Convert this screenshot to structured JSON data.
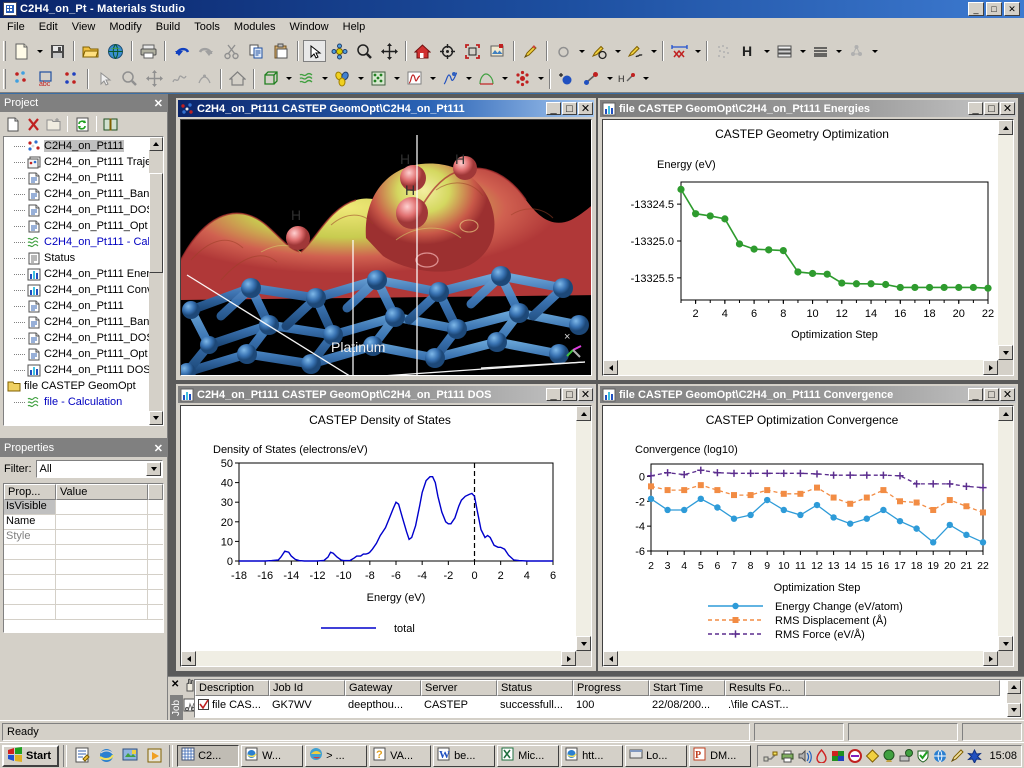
{
  "app": {
    "title": "C2H4_on_Pt - Materials Studio",
    "icon": "materials-studio-icon",
    "status": "Ready"
  },
  "window_buttons": {
    "minimize": "_",
    "maximize": "□",
    "close": "✕"
  },
  "menubar": [
    {
      "label": "File"
    },
    {
      "label": "Edit"
    },
    {
      "label": "View"
    },
    {
      "label": "Modify"
    },
    {
      "label": "Build"
    },
    {
      "label": "Tools"
    },
    {
      "label": "Modules"
    },
    {
      "label": "Window"
    },
    {
      "label": "Help"
    }
  ],
  "toolbar_row1": [
    "new-document-icon",
    "dropdown-arrow",
    "save-icon",
    "sep",
    "open-folder-icon",
    "web-globe-icon",
    "sep",
    "print-icon",
    "sep",
    "undo-icon",
    "redo-icon",
    "cut-icon",
    "copy-icon",
    "paste-icon",
    "sep",
    "select-arrow-icon",
    "rotate-icon",
    "zoom-icon",
    "translate-icon",
    "sep",
    "home-view-icon",
    "center-view-icon",
    "fit-view-icon",
    "display-style-icon",
    "sep",
    "sketch-atom-icon",
    "sep",
    "ring-icon",
    "dropdown-arrow",
    "sketch-ring-icon",
    "dropdown-arrow",
    "sketch-chain-icon",
    "dropdown-arrow",
    "sep",
    "measure-icon",
    "dropdown-arrow",
    "sep",
    "cleanup-icon",
    "hydrogen-icon",
    "dropdown-arrow",
    "layer-icon",
    "dropdown-arrow",
    "slab-icon",
    "dropdown-arrow",
    "symmetry-icon",
    "dropdown-arrow"
  ],
  "toolbar_row2": [
    "atom-label-icon",
    "abc-label-icon",
    "atom-color-icon",
    "sep",
    "select-arrow-icon",
    "zoom-icon",
    "translate-icon",
    "trajectory-icon",
    "animate-icon",
    "sep",
    "home-view-icon",
    "sep",
    "crystal-build-icon",
    "dropdown-arrow",
    "calculation-icon",
    "dropdown-arrow",
    "orbital-icon",
    "dropdown-arrow",
    "lattice-icon",
    "dropdown-arrow",
    "spectrum-icon",
    "dropdown-arrow",
    "dos-icon",
    "dropdown-arrow",
    "potential-icon",
    "dropdown-arrow",
    "atomistic-icon",
    "dropdown-arrow",
    "sep",
    "add-atom-icon",
    "bond-icon",
    "dropdown-arrow",
    "hydrogen-bond-icon",
    "dropdown-arrow"
  ],
  "project_panel": {
    "title": "Project",
    "close_label": "✕",
    "tools": [
      "new-project-icon",
      "delete-icon",
      "new-folder-icon",
      "sep",
      "refresh-icon",
      "sep",
      "help-book-icon"
    ],
    "items": [
      {
        "label": "C2H4_on_Pt111",
        "icon": "structure-3d-icon",
        "selected": true,
        "indent": 1
      },
      {
        "label": "C2H4_on_Pt111 Traje",
        "icon": "trajectory-doc-icon",
        "indent": 1
      },
      {
        "label": "C2H4_on_Pt111",
        "icon": "text-doc-icon",
        "indent": 1
      },
      {
        "label": "C2H4_on_Pt111_Ban",
        "icon": "text-doc-icon",
        "indent": 1
      },
      {
        "label": "C2H4_on_Pt111_DOS",
        "icon": "text-doc-icon",
        "indent": 1
      },
      {
        "label": "C2H4_on_Pt111_Opt",
        "icon": "text-doc-icon",
        "indent": 1
      },
      {
        "label": "C2H4_on_Pt111 - Cal",
        "icon": "calculation-icon",
        "calc": true,
        "indent": 1
      },
      {
        "label": "Status",
        "icon": "status-doc-icon",
        "indent": 1
      },
      {
        "label": "C2H4_on_Pt111 Ener",
        "icon": "chart-doc-icon",
        "indent": 1
      },
      {
        "label": "C2H4_on_Pt111 Conv",
        "icon": "chart-doc-icon",
        "indent": 1
      },
      {
        "label": "C2H4_on_Pt111",
        "icon": "text-doc-icon",
        "indent": 1
      },
      {
        "label": "C2H4_on_Pt111_Ban",
        "icon": "text-doc-icon",
        "indent": 1
      },
      {
        "label": "C2H4_on_Pt111_DOS",
        "icon": "text-doc-icon",
        "indent": 1
      },
      {
        "label": "C2H4_on_Pt111_Opt",
        "icon": "text-doc-icon",
        "indent": 1
      },
      {
        "label": "C2H4_on_Pt111 DOS",
        "icon": "chart-doc-icon",
        "indent": 1
      },
      {
        "label": "file CASTEP GeomOpt",
        "icon": "folder-icon",
        "indent": 0
      },
      {
        "label": "file - Calculation",
        "icon": "calculation-icon",
        "calc": true,
        "indent": 1
      }
    ]
  },
  "properties_panel": {
    "title": "Properties",
    "close_label": "✕",
    "filter_label": "Filter:",
    "filter_value": "All",
    "columns": [
      "Prop...",
      "Value",
      ""
    ],
    "rows": [
      {
        "name": "IsVisible",
        "value": "",
        "highlighted": true
      },
      {
        "name": "Name",
        "value": ""
      },
      {
        "name": "Style",
        "value": "",
        "dim": true
      },
      {
        "name": "",
        "value": ""
      },
      {
        "name": "",
        "value": ""
      },
      {
        "name": "",
        "value": ""
      },
      {
        "name": "",
        "value": ""
      },
      {
        "name": "",
        "value": ""
      }
    ]
  },
  "windows": {
    "structure": {
      "title": "C2H4_on_Pt111 CASTEP GeomOpt\\C2H4_on_Pt111",
      "icon": "molecule-icon",
      "active": true,
      "atom_labels": [
        "H",
        "H",
        "H",
        "H"
      ],
      "surface_label": "Platinum"
    },
    "energies": {
      "title": "file CASTEP GeomOpt\\C2H4_on_Pt111  Energies",
      "icon": "chart-doc-icon",
      "active": false
    },
    "dos": {
      "title": "C2H4_on_Pt111 CASTEP GeomOpt\\C2H4_on_Pt111 DOS",
      "icon": "chart-doc-icon",
      "active": false
    },
    "convergence": {
      "title": "file CASTEP GeomOpt\\C2H4_on_Pt111 Convergence",
      "icon": "chart-doc-icon",
      "active": false
    }
  },
  "chart_data": [
    {
      "id": "energies",
      "type": "line",
      "title": "CASTEP Geometry Optimization",
      "ylabel": "Energy (eV)",
      "xlabel": "Optimization Step",
      "xlim": [
        1,
        22
      ],
      "ylim": [
        -13325.8,
        -13324.2
      ],
      "xticks": [
        2,
        4,
        6,
        8,
        10,
        12,
        14,
        16,
        18,
        20,
        22
      ],
      "yticks": [
        -13324.5,
        -13325.0,
        -13325.5
      ],
      "ytick_labels": [
        "-13324.5",
        "-13325.0",
        "-13325.5"
      ],
      "grid": false,
      "color": "#2e9b2e",
      "marker": "circle",
      "x": [
        1,
        2,
        3,
        4,
        5,
        6,
        7,
        8,
        9,
        10,
        11,
        12,
        13,
        14,
        15,
        16,
        17,
        18,
        19,
        20,
        21,
        22
      ],
      "values": [
        -13324.3,
        -13324.63,
        -13324.66,
        -13324.7,
        -13325.04,
        -13325.11,
        -13325.12,
        -13325.13,
        -13325.42,
        -13325.44,
        -13325.45,
        -13325.57,
        -13325.58,
        -13325.58,
        -13325.59,
        -13325.63,
        -13325.63,
        -13325.63,
        -13325.63,
        -13325.63,
        -13325.63,
        -13325.64
      ]
    },
    {
      "id": "dos",
      "type": "line",
      "title": "CASTEP Density of States",
      "ylabel": "Density of States (electrons/eV)",
      "xlabel": "Energy (eV)",
      "xlim": [
        -18,
        6
      ],
      "ylim": [
        0,
        50
      ],
      "xticks": [
        -18,
        -16,
        -14,
        -12,
        -10,
        -8,
        -6,
        -4,
        -2,
        0,
        2,
        4,
        6
      ],
      "yticks": [
        0,
        10,
        20,
        30,
        40,
        50
      ],
      "grid": false,
      "color": "#0000cc",
      "fermi_line": 0,
      "fermi_style": "dashed",
      "legend": [
        {
          "label": "total",
          "color": "#0000cc"
        }
      ],
      "legend_position": "bottom",
      "x": [
        -18,
        -17.5,
        -17,
        -16.5,
        -16,
        -15.5,
        -15,
        -14.8,
        -14.5,
        -14.2,
        -14,
        -13.7,
        -13.4,
        -13,
        -12.5,
        -12,
        -11.5,
        -11.2,
        -11,
        -10.8,
        -10.5,
        -10.2,
        -10,
        -9.5,
        -9.2,
        -9,
        -8.7,
        -8.5,
        -8.3,
        -8.1,
        -8,
        -7.8,
        -7.5,
        -7.2,
        -7,
        -6.8,
        -6.5,
        -6.2,
        -6,
        -5.8,
        -5.5,
        -5.2,
        -5,
        -4.8,
        -4.5,
        -4.2,
        -4,
        -3.7,
        -3.4,
        -3.2,
        -3,
        -2.8,
        -2.5,
        -2.2,
        -2,
        -1.8,
        -1.5,
        -1.2,
        -1,
        -0.7,
        -0.4,
        -0.2,
        0,
        0.2,
        0.5,
        0.8,
        1,
        1.2,
        1.5,
        1.8,
        2,
        2.3,
        2.6,
        3,
        3.4,
        4,
        4.5,
        5,
        5.5,
        6
      ],
      "values": [
        0,
        0,
        0,
        0,
        0,
        0.2,
        0.5,
        2,
        5,
        4.5,
        2.5,
        0.8,
        0.2,
        0,
        0,
        0,
        0.3,
        2,
        4.5,
        4,
        2,
        0.5,
        0.2,
        0.3,
        1.5,
        2.5,
        2.5,
        3.5,
        3.5,
        4,
        4.5,
        6,
        9,
        13,
        15,
        17,
        22,
        27,
        30,
        29,
        22,
        15,
        11,
        12,
        18,
        28,
        35,
        41,
        43,
        43,
        40,
        33,
        25,
        20,
        19,
        19,
        22,
        28,
        31,
        33,
        34,
        34.5,
        33,
        26,
        16,
        12,
        13,
        12,
        8,
        7,
        7,
        6,
        3,
        0.5,
        0.2,
        0,
        0,
        0,
        0,
        0
      ]
    },
    {
      "id": "convergence",
      "type": "line",
      "title": "CASTEP Optimization Convergence",
      "ylabel": "Convergence (log10)",
      "xlabel": "Optimization Step",
      "xlim": [
        2,
        22
      ],
      "ylim": [
        -6,
        1
      ],
      "xticks": [
        2,
        3,
        4,
        5,
        6,
        7,
        8,
        9,
        10,
        11,
        12,
        13,
        14,
        15,
        16,
        17,
        18,
        19,
        20,
        21,
        22
      ],
      "yticks": [
        0,
        -2,
        -4,
        -6
      ],
      "grid": false,
      "legend_position": "bottom",
      "x": [
        2,
        3,
        4,
        5,
        6,
        7,
        8,
        9,
        10,
        11,
        12,
        13,
        14,
        15,
        16,
        17,
        18,
        19,
        20,
        21,
        22
      ],
      "series": [
        {
          "name": "Energy Change (eV/atom)",
          "color": "#2e9bd8",
          "marker": "circle",
          "linestyle": "solid",
          "values": [
            -1.8,
            -2.7,
            -2.7,
            -1.8,
            -2.5,
            -3.4,
            -3.1,
            -1.9,
            -2.7,
            -3.1,
            -2.3,
            -3.3,
            -3.8,
            -3.4,
            -2.7,
            -3.6,
            -4.2,
            -5.3,
            -3.9,
            -4.7,
            -5.3
          ]
        },
        {
          "name": "RMS Displacement (Å)",
          "color": "#f28c44",
          "marker": "square",
          "linestyle": "dashed",
          "values": [
            -0.8,
            -1.1,
            -1.1,
            -0.7,
            -1.1,
            -1.5,
            -1.5,
            -1.1,
            -1.4,
            -1.4,
            -0.9,
            -1.7,
            -2.2,
            -1.7,
            -1.1,
            -2.0,
            -2.1,
            -2.7,
            -1.9,
            -2.4,
            -2.9
          ]
        },
        {
          "name": "RMS Force (eV/Å)",
          "color": "#5b2d8e",
          "marker": "plus",
          "linestyle": "dashed",
          "values": [
            0.05,
            0.3,
            0.15,
            0.5,
            0.3,
            0.25,
            0.25,
            0.25,
            0.25,
            0.25,
            0.2,
            0.1,
            0.1,
            0.1,
            0.1,
            0.05,
            -0.6,
            -0.6,
            -0.6,
            -0.8,
            -0.9
          ]
        }
      ]
    }
  ],
  "job_explorer": {
    "vertical_tab": "Job",
    "close_label": "✕",
    "side_icons": [
      "hand-icon",
      "job-explorer-icon"
    ],
    "columns": [
      "Description",
      "Job Id",
      "Gateway",
      "Server",
      "Status",
      "Progress",
      "Start Time",
      "Results Fo...",
      ""
    ],
    "rows": [
      {
        "checked": true,
        "description": "file CAS...",
        "job_id": "GK7WV",
        "gateway": "deepthou...",
        "server": "CASTEP",
        "status": "successfull...",
        "progress": "100",
        "start_time": "22/08/200...",
        "results_folder": ".\\file CAST..."
      }
    ]
  },
  "taskbar": {
    "start_label": "Start",
    "quick_launch": [
      "notepad-icon",
      "internet-explorer-icon",
      "show-desktop-icon",
      "media-player-icon"
    ],
    "buttons": [
      {
        "label": "C2...",
        "icon": "materials-studio-icon",
        "active": true
      },
      {
        "label": "W...",
        "icon": "explorer-icon"
      },
      {
        "label": "> ...",
        "icon": "terminal-icon"
      },
      {
        "label": "VA...",
        "icon": "help-icon"
      },
      {
        "label": "be...",
        "icon": "word-icon"
      },
      {
        "label": "Mic...",
        "icon": "excel-icon"
      },
      {
        "label": "htt...",
        "icon": "explorer-icon"
      },
      {
        "label": "Lo...",
        "icon": "window-icon"
      },
      {
        "label": "DM...",
        "icon": "powerpoint-icon"
      }
    ],
    "tray_icons": [
      "plug-icon",
      "printer-icon",
      "volume-icon",
      "droplet-icon",
      "flag-icon",
      "circle-icon",
      "diamond-icon",
      "globe-icon",
      "network-icon",
      "shield-icon",
      "search-globe-icon",
      "pen-icon",
      "star-icon"
    ],
    "clock": "15:08"
  }
}
